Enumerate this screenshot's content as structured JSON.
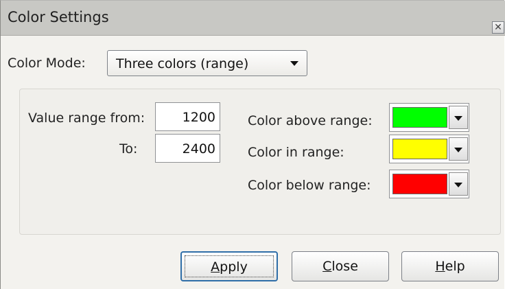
{
  "window": {
    "title": "Color Settings",
    "close_glyph": "✕"
  },
  "color_mode": {
    "label": "Color Mode:",
    "selected": "Three colors (range)"
  },
  "range": {
    "from_label": "Value range from:",
    "from_value": "1200",
    "to_label": "To:",
    "to_value": "2400"
  },
  "colors": {
    "above_label": "Color above range:",
    "above_color": "#00ff00",
    "in_label": "Color in range:",
    "in_color": "#ffff00",
    "below_label": "Color below range:",
    "below_color": "#ff0000"
  },
  "buttons": {
    "apply_mnemonic": "A",
    "apply_rest": "pply",
    "close_mnemonic": "C",
    "close_rest": "lose",
    "help_mnemonic": "H",
    "help_rest": "elp"
  }
}
